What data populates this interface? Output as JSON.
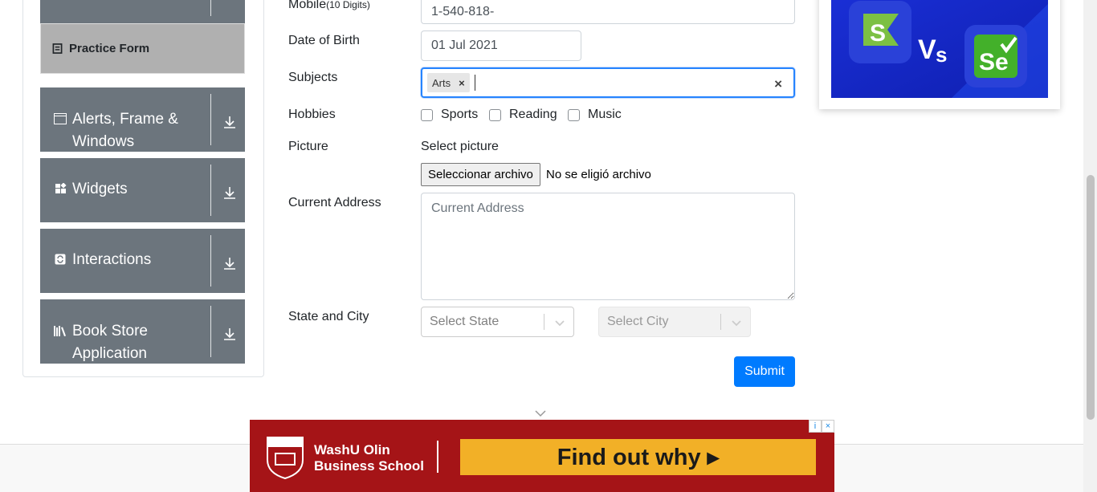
{
  "sidebar": {
    "active_item": "Practice Form",
    "groups": [
      {
        "label_line1": "Alerts, Frame &",
        "label_line2": "Windows"
      },
      {
        "label_line1": "Widgets",
        "label_line2": ""
      },
      {
        "label_line1": "Interactions",
        "label_line2": ""
      },
      {
        "label_line1": "Book Store",
        "label_line2": "Application"
      }
    ]
  },
  "form": {
    "mobile_label": "Mobile",
    "mobile_hint": "(10 Digits)",
    "mobile_value": "1-540-818-",
    "dob_label": "Date of Birth",
    "dob_value": "01 Jul 2021",
    "subjects_label": "Subjects",
    "subject_tag": "Arts",
    "subject_tag_remove": "×",
    "subjects_clear": "×",
    "hobbies_label": "Hobbies",
    "hobbies": [
      "Sports",
      "Reading",
      "Music"
    ],
    "picture_label": "Picture",
    "picture_select": "Select picture",
    "file_button": "Seleccionar archivo",
    "file_status": "No se eligió archivo",
    "address_label": "Current Address",
    "address_placeholder": "Current Address",
    "state_city_label": "State and City",
    "state_placeholder": "Select State",
    "city_placeholder": "Select City",
    "submit_label": "Submit"
  },
  "bottom_ad": {
    "school_line1": "WashU Olin",
    "school_line2": "Business School",
    "cta": "Find out why ▸",
    "badge_info": "i",
    "badge_close": "×"
  },
  "colors": {
    "sidebar_bg": "#6c757d",
    "active_bg": "#b0b0b0",
    "primary": "#007bff",
    "ad_red": "#a51417",
    "ad_yellow": "#f2b027"
  }
}
